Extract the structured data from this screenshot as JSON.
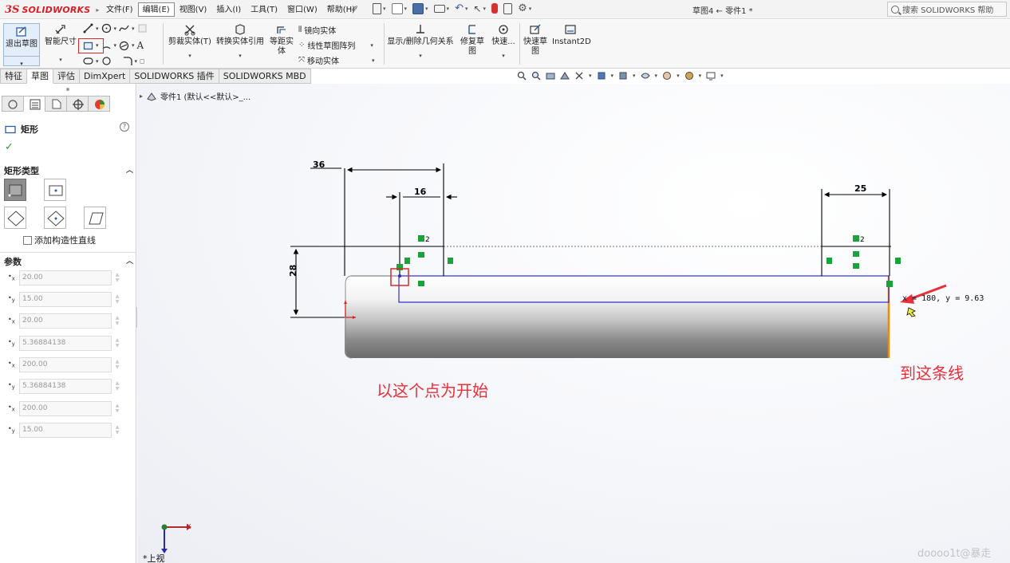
{
  "app": {
    "logo_prefix": "3S",
    "logo_text": "SOLIDWORKS",
    "document_title": "草图4 ← 零件1 *"
  },
  "menu": {
    "items": [
      "文件(F)",
      "编辑(E)",
      "视图(V)",
      "插入(I)",
      "工具(T)",
      "窗口(W)",
      "帮助(H)"
    ],
    "active_item": "编辑(E)"
  },
  "search": {
    "placeholder": "搜索 SOLIDWORKS 帮助"
  },
  "ribbon": {
    "exit_sketch": "退出草图",
    "smart_dimension": "智能尺寸",
    "trim_entities": "剪裁实体(T)",
    "convert_entities": "转换实体引用",
    "offset_entities": "等距实\n体",
    "offset_line1": "等距实",
    "offset_line2": "体",
    "mirror_entities": "镜向实体",
    "linear_pattern": "线性草图阵列",
    "move_entities": "移动实体",
    "display_relations": "显示/删除几何关系",
    "repair_sketch_line1": "修复草",
    "repair_sketch_line2": "图",
    "quick_snaps": "快速...",
    "rapid_sketch_line1": "快速草",
    "rapid_sketch_line2": "图",
    "instant2d": "Instant2D"
  },
  "command_tabs": [
    "特征",
    "草图",
    "评估",
    "DimXpert",
    "SOLIDWORKS 插件",
    "SOLIDWORKS MBD"
  ],
  "active_command_tab": "草图",
  "property_manager": {
    "title": "矩形",
    "rect_type_heading": "矩形类型",
    "add_construction_label": "添加构造性直线",
    "add_construction_checked": false,
    "params_heading": "参数",
    "params": [
      {
        "axis": "x",
        "value": "20.00"
      },
      {
        "axis": "y",
        "value": "15.00"
      },
      {
        "axis": "x",
        "value": "20.00"
      },
      {
        "axis": "y",
        "value": "5.36884138"
      },
      {
        "axis": "x",
        "value": "200.00"
      },
      {
        "axis": "y",
        "value": "5.36884138"
      },
      {
        "axis": "x",
        "value": "200.00"
      },
      {
        "axis": "y",
        "value": "15.00"
      }
    ]
  },
  "feature_tree": {
    "root_label": "零件1 (默认<<默认>_..."
  },
  "sketch": {
    "dimensions": {
      "d36": "36",
      "d16": "16",
      "d25": "25",
      "d28": "28"
    },
    "relation_marks": {
      "r2a": "2",
      "r2b": "2"
    },
    "coordinate_readout": "x = 180, y = 9.63",
    "colors": {
      "sketch_line": "#1f1fd6",
      "dimension": "#000000",
      "relation": "#1aa33a",
      "highlight_edge": "#f08a00",
      "annotation": "#e8303a"
    }
  },
  "annotations": {
    "start_note": "以这个点为开始",
    "end_note": "到这条线"
  },
  "orientation": {
    "view_label": "*上视",
    "x_axis": "X"
  },
  "watermark": "doooo1t@暴走"
}
